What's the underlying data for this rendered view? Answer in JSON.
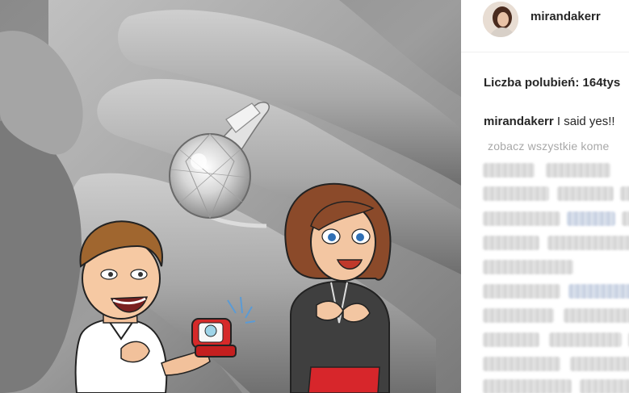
{
  "post": {
    "username": "mirandakerr",
    "likes_label": "Liczba polubień:",
    "likes_count": "164tys",
    "caption_user": "mirandakerr",
    "caption_text": "I said yes!!",
    "view_all_label": "zobacz wszystkie kome"
  },
  "colors": {
    "text": "#262626",
    "muted": "#a8a8a8",
    "divider": "#efefef"
  },
  "icons": {
    "photo_overlays": [
      "man-bitmoji-holding-ring-box",
      "woman-bitmoji-hands-on-heart"
    ]
  }
}
